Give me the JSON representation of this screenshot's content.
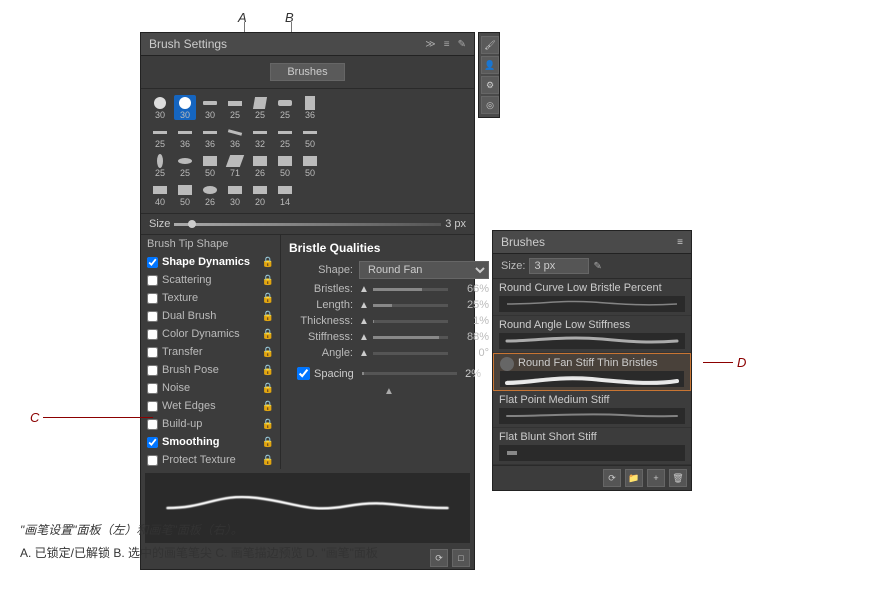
{
  "annotations": {
    "a_label": "A",
    "b_label": "B",
    "c_label": "C",
    "d_label": "D"
  },
  "brush_settings_panel": {
    "title": "Brush Settings",
    "brushes_btn": "Brushes",
    "size_label": "Size",
    "size_value": "3 px",
    "bristle_qualities_title": "Bristle Qualities",
    "shape_label": "Shape:",
    "shape_value": "Round Fan",
    "bristles_label": "Bristles:",
    "bristles_value": "66%",
    "length_label": "Length:",
    "length_value": "25%",
    "thickness_label": "Thickness:",
    "thickness_value": "1%",
    "stiffness_label": "Stiffness:",
    "stiffness_value": "88%",
    "angle_label": "Angle:",
    "angle_value": "0°",
    "spacing_label": "Spacing",
    "spacing_value": "2%",
    "options": [
      {
        "label": "Brush Tip Shape",
        "checked": false,
        "type": "link"
      },
      {
        "label": "Shape Dynamics",
        "checked": true,
        "type": "check",
        "lock": true
      },
      {
        "label": "Scattering",
        "checked": false,
        "type": "check",
        "lock": true
      },
      {
        "label": "Texture",
        "checked": false,
        "type": "check",
        "lock": true
      },
      {
        "label": "Dual Brush",
        "checked": false,
        "type": "check",
        "lock": true
      },
      {
        "label": "Color Dynamics",
        "checked": false,
        "type": "check",
        "lock": true
      },
      {
        "label": "Transfer",
        "checked": false,
        "type": "check",
        "lock": true
      },
      {
        "label": "Brush Pose",
        "checked": false,
        "type": "check",
        "lock": true
      },
      {
        "label": "Noise",
        "checked": false,
        "type": "check",
        "lock": true
      },
      {
        "label": "Wet Edges",
        "checked": false,
        "type": "check",
        "lock": true
      },
      {
        "label": "Build-up",
        "checked": false,
        "type": "check",
        "lock": true
      },
      {
        "label": "Smoothing",
        "checked": true,
        "type": "check",
        "lock": true
      },
      {
        "label": "Protect Texture",
        "checked": false,
        "type": "check",
        "lock": true
      }
    ]
  },
  "brushes_panel": {
    "title": "Brushes",
    "size_label": "Size:",
    "size_value": "3 px",
    "brushes": [
      {
        "name": "Round Curve Low Bristle Percent",
        "selected": false
      },
      {
        "name": "Round Angle Low Stiffness",
        "selected": false
      },
      {
        "name": "Round Fan Stiff Thin Bristles",
        "selected": true
      },
      {
        "name": "Flat Point Medium Stiff",
        "selected": false
      },
      {
        "name": "Flat Blunt Short Stiff",
        "selected": false
      }
    ]
  },
  "caption": {
    "line1": "\"画笔设置\"面板（左）和画笔\"面板（右）。",
    "line2": "A. 已锁定/已解锁 B. 选中的画笔笔尖 C. 画笔描边预览 D. \"画笔\"面板"
  }
}
